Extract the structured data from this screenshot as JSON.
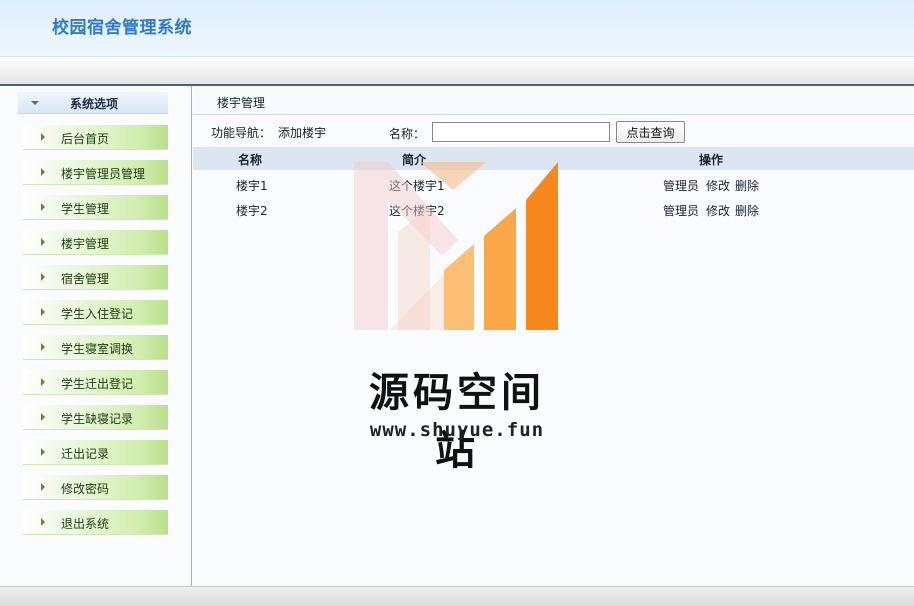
{
  "app": {
    "title": "校园宿舍管理系统"
  },
  "sidebar": {
    "header": "系统选项",
    "items": [
      {
        "label": "后台首页"
      },
      {
        "label": "楼宇管理员管理"
      },
      {
        "label": "学生管理"
      },
      {
        "label": "楼宇管理"
      },
      {
        "label": "宿舍管理"
      },
      {
        "label": "学生入住登记"
      },
      {
        "label": "学生寝室调换"
      },
      {
        "label": "学生迁出登记"
      },
      {
        "label": "学生缺寝记录"
      },
      {
        "label": "迁出记录"
      },
      {
        "label": "修改密码"
      },
      {
        "label": "退出系统"
      }
    ]
  },
  "main": {
    "breadcrumb": "楼宇管理",
    "toolbar": {
      "nav_label": "功能导航：",
      "add_link": "添加楼宇",
      "name_label": "名称：",
      "name_value": "",
      "query_button": "点击查询"
    },
    "table": {
      "columns": [
        "名称",
        "简介",
        "操作"
      ],
      "rows": [
        {
          "name": "楼宇1",
          "intro": "这个楼宇1",
          "ops": [
            "管理员",
            "修改",
            "删除"
          ]
        },
        {
          "name": "楼宇2",
          "intro": "这个楼宇2",
          "ops": [
            "管理员",
            "修改",
            "删除"
          ]
        }
      ]
    }
  },
  "watermark": {
    "name": "源码空间站",
    "url": "www.shuyue.fun"
  },
  "colors": {
    "title_blue": "#2f7cc5",
    "menu_green": "#b9e08c",
    "grid_header": "#dbe6f2",
    "logo_orange": "#f7891c"
  }
}
